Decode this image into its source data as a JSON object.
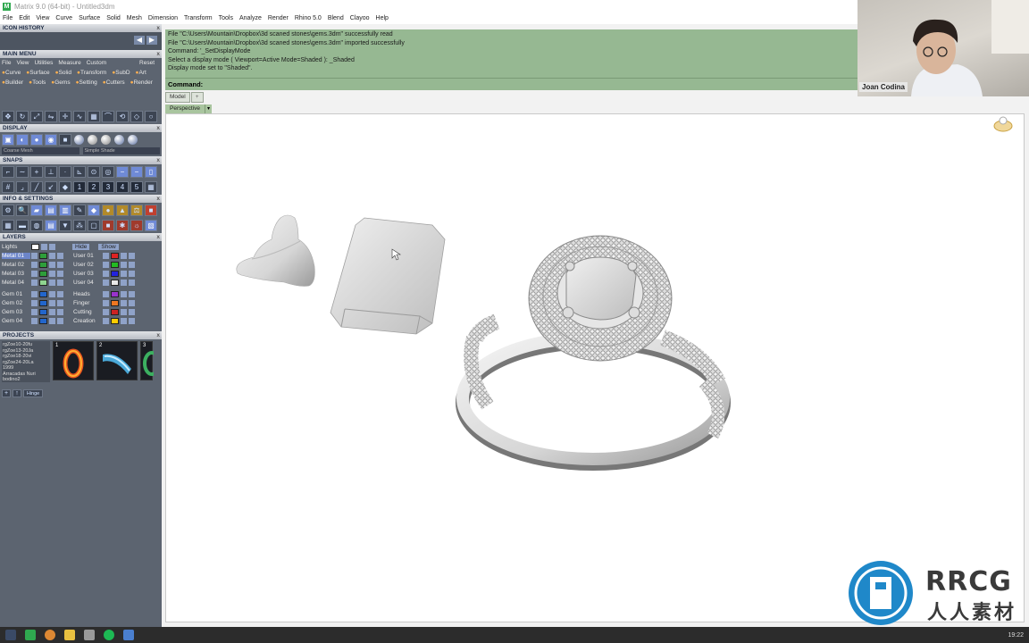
{
  "window": {
    "title": "Matrix 9.0 (64-bit) - Untitled3dm"
  },
  "menu": [
    "File",
    "Edit",
    "View",
    "Curve",
    "Surface",
    "Solid",
    "Mesh",
    "Dimension",
    "Transform",
    "Tools",
    "Analyze",
    "Render",
    "Rhino 5.0",
    "Blend",
    "Clayoo",
    "Help"
  ],
  "panels": {
    "icon_history": "ICON HISTORY",
    "main_menu": "MAIN MENU",
    "display": "DISPLAY",
    "snaps": "SNAPS",
    "info_settings": "INFO & SETTINGS",
    "layers": "LAYERS",
    "projects": "PROJECTS",
    "close": "x"
  },
  "main_menu": {
    "row1": [
      "File",
      "View",
      "Utilities",
      "Measure",
      "Custom"
    ],
    "reset": "Reset",
    "row2": [
      "Curve",
      "Surface",
      "Solid",
      "Transform",
      "SubD",
      "Art"
    ],
    "row3": [
      "Builder",
      "Tools",
      "Gems",
      "Setting",
      "Cutters",
      "Render"
    ]
  },
  "display": {
    "mesh_mode": "Coarse Mesh",
    "shade_mode": "Simple Shade"
  },
  "layers": {
    "lights": "Lights",
    "hide": "Hide",
    "show": "Show",
    "left": [
      {
        "name": "Metal 01",
        "color": "#2e9e3a",
        "selected": true
      },
      {
        "name": "Metal 02",
        "color": "#2e9e3a"
      },
      {
        "name": "Metal 03",
        "color": "#2e9e3a"
      },
      {
        "name": "Metal 04",
        "color": "#8fd48f"
      },
      {
        "name": "Gem 01",
        "color": "#2266cc"
      },
      {
        "name": "Gem 02",
        "color": "#2266cc"
      },
      {
        "name": "Gem 03",
        "color": "#2266cc"
      },
      {
        "name": "Gem 04",
        "color": "#2266cc"
      }
    ],
    "right": [
      {
        "name": "User 01",
        "color": "#dd2222"
      },
      {
        "name": "User 02",
        "color": "#22bb22"
      },
      {
        "name": "User 03",
        "color": "#2222dd"
      },
      {
        "name": "User 04",
        "color": "#e8e8e8"
      },
      {
        "name": "Heads",
        "color": "#9933cc"
      },
      {
        "name": "Finger",
        "color": "#ee7722"
      },
      {
        "name": "Cutting",
        "color": "#cc2222"
      },
      {
        "name": "Creation",
        "color": "#ffcc00"
      }
    ]
  },
  "projects": {
    "files": [
      "rgZoe10-20fu",
      "rgZoe13-20Ja",
      "rgZoe18-20vi",
      "rgZoe24-20La",
      "1999",
      "Arracadas Nuri",
      "bodino2"
    ],
    "thumbs": [
      "1",
      "2",
      "3"
    ],
    "hinge": "Hinge"
  },
  "command": {
    "history": [
      "File \"C:\\Users\\Mountain\\Dropbox\\3d scaned stones\\gems.3dm\" successfully read",
      "File \"C:\\Users\\Mountain\\Dropbox\\3d scaned stones\\gems.3dm\" imported successfully",
      "Command: '_SetDisplayMode",
      "Select a display mode ( Viewport=Active  Mode=Shaded ): _Shaded",
      "Display mode set to \"Shaded\"."
    ],
    "prompt": "Command:"
  },
  "tabs": {
    "model": "Model",
    "add": "+"
  },
  "viewport": {
    "name": "Perspective",
    "dropdown": "▾"
  },
  "webcam": {
    "name": "Joan Codina"
  },
  "watermark": {
    "brand": "RRCG",
    "cn": "人人素材"
  },
  "taskbar": {
    "clock": "19:22"
  }
}
